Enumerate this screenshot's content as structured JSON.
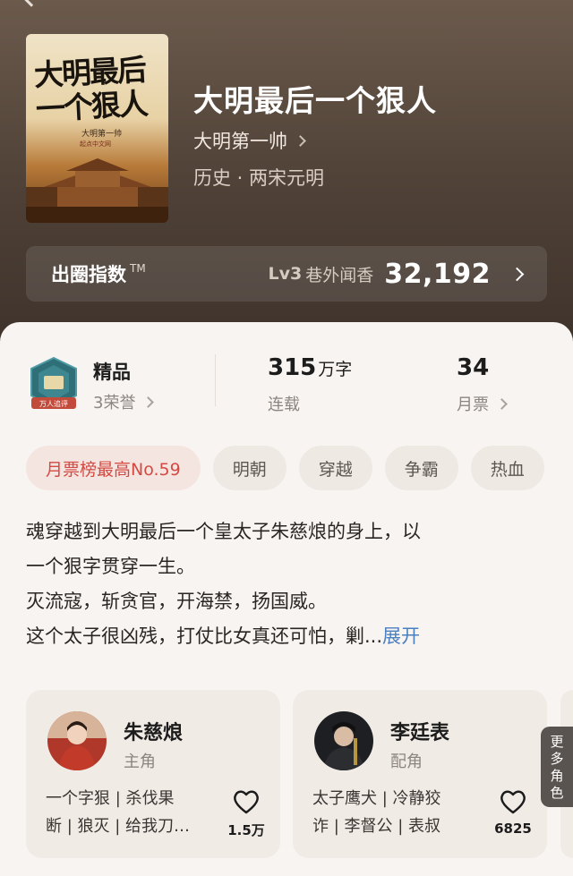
{
  "book": {
    "title": "大明最后一个狠人",
    "author": "大明第一帅",
    "genre": "历史 · 两宋元明",
    "cover": {
      "title_line1": "大明最后",
      "title_line2": "一个狠人",
      "author": "大明第一帅",
      "publisher": "起点中文网"
    }
  },
  "index": {
    "label": "出圈指数",
    "tm": "TM",
    "level": "Lv3",
    "level_desc": "巷外闻香",
    "score": "32,192"
  },
  "stats": {
    "quality": "精品",
    "honors": "3荣誉",
    "badge_text": "万人追评",
    "words": "315",
    "words_unit": "万字",
    "status": "连载",
    "votes": "34",
    "votes_label": "月票"
  },
  "tags": [
    "月票榜最高No.59",
    "明朝",
    "穿越",
    "争霸",
    "热血"
  ],
  "synopsis": {
    "line1": "魂穿越到大明最后一个皇太子朱慈烺的身上，以",
    "line2": "一个狠字贯穿一生。",
    "line3": "灭流寇，斩贪官，开海禁，扬国威。",
    "line4": "这个太子很凶残，打仗比女真还可怕，剿...",
    "expand": "展开"
  },
  "characters": [
    {
      "name": "朱慈烺",
      "role": "主角",
      "tags_line1": "一个字狠 | 杀伐果",
      "tags_line2": "断 | 狼灭 | 给我刀…",
      "likes": "1.5万"
    },
    {
      "name": "李廷表",
      "role": "配角",
      "tags_line1": "太子鹰犬 | 冷静狡",
      "tags_line2": "诈 | 李督公 | 表叔",
      "likes": "6825"
    }
  ],
  "more_roles": "更多角色",
  "colors": {
    "hero_bg": "#4e4036",
    "panel_bg": "#f8f4f1",
    "hot_tag": "#d44a42",
    "link": "#4a7fc0"
  },
  "icons": [
    "back-arrow-icon",
    "chevron-right-icon",
    "heart-icon",
    "badge-icon"
  ]
}
